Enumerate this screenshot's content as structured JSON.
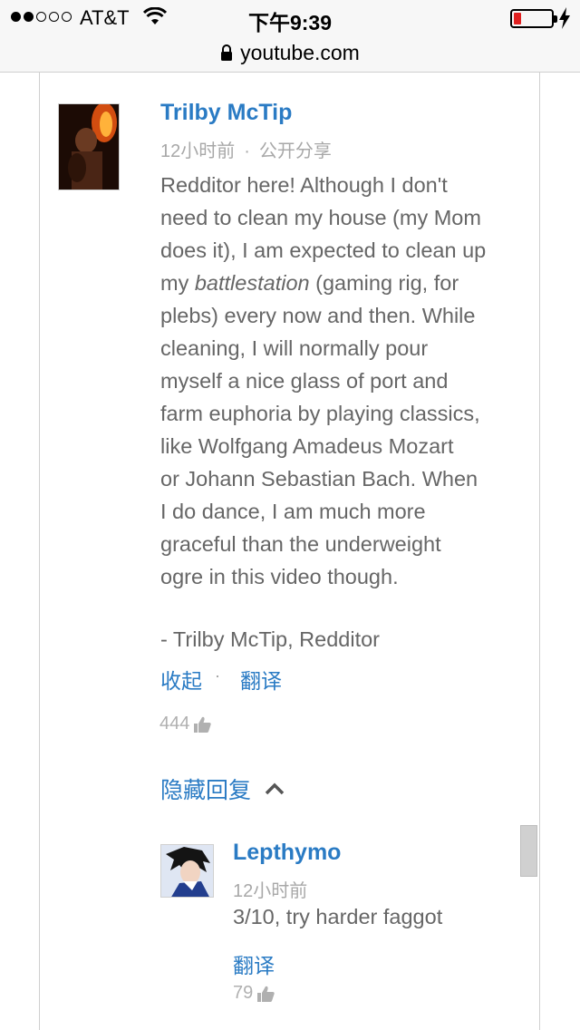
{
  "status_bar": {
    "carrier": "AT&T",
    "time": "下午9:39",
    "signal_filled": 2,
    "signal_total": 5,
    "battery_level": 0.12,
    "battery_color": "#e02020",
    "charging": true
  },
  "url_bar": {
    "url": "youtube.com",
    "icon": "lock-icon"
  },
  "comment": {
    "author": "Trilby McTip",
    "time": "12小时前",
    "meta_separator": "·",
    "visibility": "公开分享",
    "body_lines": [
      "Redditor here! Although I don't",
      "need to clean my house (my Mom",
      "does it), I am expected to clean up",
      "my |battlestation| (gaming rig, for",
      "plebs) every now and then.  While",
      "cleaning, I will normally pour",
      "myself a nice glass of port and",
      "farm euphoria by playing classics,",
      "like Wolfgang Amadeus Mozart",
      "or Johann Sebastian Bach. When",
      "I do dance, I am much more",
      "graceful than the underweight",
      "ogre in this video though."
    ],
    "body_line4_pre": "my ",
    "body_line4_em": "battlestation",
    "body_line4_post": " (gaming rig, for",
    "signature": "- Trilby McTip, Redditor",
    "collapse_label": "收起",
    "action_separator": "·",
    "translate_label": "翻译",
    "likes": "444"
  },
  "replies_toggle": {
    "label": "隐藏回复",
    "icon": "chevron-up-icon"
  },
  "reply": {
    "author": "Lepthymo",
    "time": "12小时前",
    "body": "3/10, try harder faggot",
    "translate_label": "翻译",
    "likes": "79"
  },
  "colors": {
    "link": "#2a7bc4",
    "body_text": "#666666",
    "meta_text": "#a8a8a8"
  }
}
